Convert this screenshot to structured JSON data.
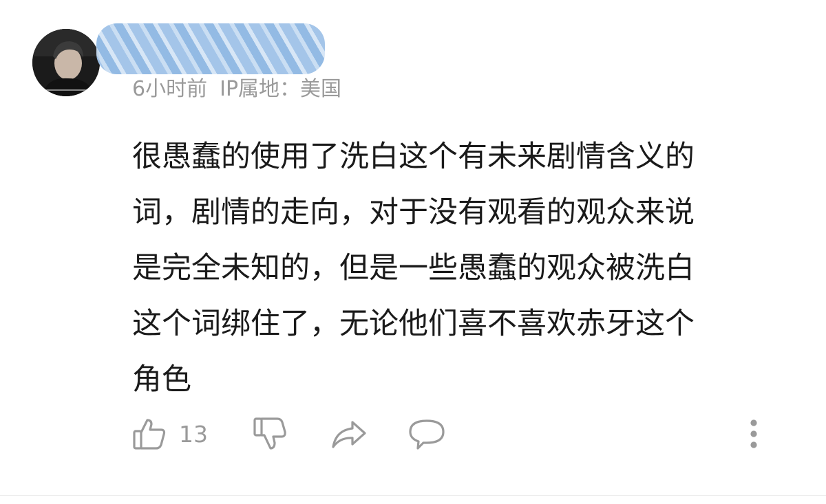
{
  "comment": {
    "meta": {
      "time": "6小时前",
      "ip_location": "IP属地：美国"
    },
    "body_lines": [
      "很愚蠢的使用了洗白这个有未来剧情含义的",
      "词，剧情的走向，对于没有观看的观众来说",
      "是完全未知的，但是一些愚蠢的观众被洗白",
      "这个词绑住了，无论他们喜不喜欢赤牙这个",
      "角色"
    ],
    "actions": {
      "like_count": "13"
    }
  },
  "icons": {
    "like": "thumbs-up-icon",
    "dislike": "thumbs-down-icon",
    "share": "share-icon",
    "reply": "comment-icon",
    "more": "more-vertical-icon"
  },
  "colors": {
    "meta_text": "#9a9a9a",
    "body_text": "#1a1a1a",
    "redaction": "#9fc2e8"
  }
}
